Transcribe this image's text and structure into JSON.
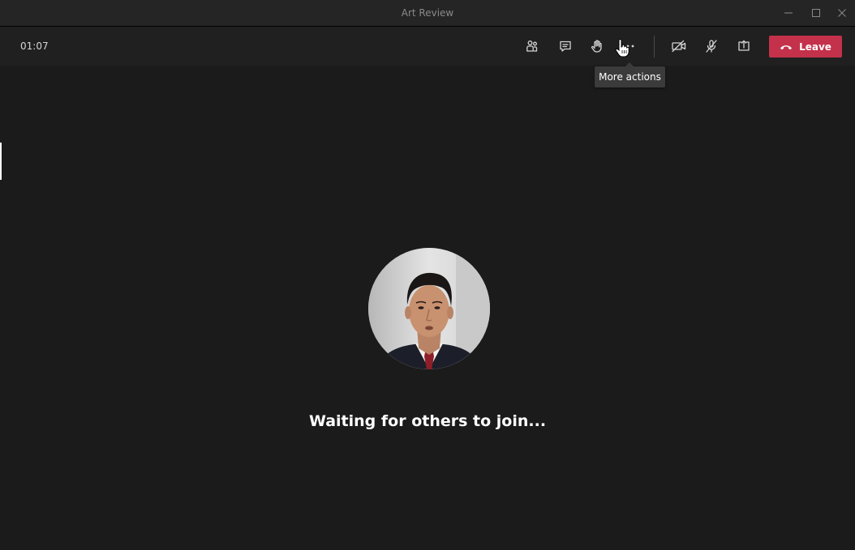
{
  "window": {
    "title": "Art Review"
  },
  "toolbar": {
    "timer": "01:07",
    "buttons": [
      {
        "id": "participants",
        "icon": "participants-icon"
      },
      {
        "id": "chat",
        "icon": "chat-icon"
      },
      {
        "id": "raise-hand",
        "icon": "raise-hand-icon"
      },
      {
        "id": "more-actions",
        "icon": "more-dots-icon"
      },
      {
        "id": "camera",
        "icon": "camera-off-icon"
      },
      {
        "id": "mic",
        "icon": "mic-off-icon"
      },
      {
        "id": "share",
        "icon": "share-screen-icon"
      }
    ],
    "leave_label": "Leave",
    "leave_color": "#c4314b"
  },
  "tooltip": {
    "text": "More actions"
  },
  "main": {
    "status": "Waiting for others to join..."
  },
  "colors": {
    "background": "#1b1b1b",
    "toolbar": "#202020",
    "titlebar": "#252525"
  }
}
